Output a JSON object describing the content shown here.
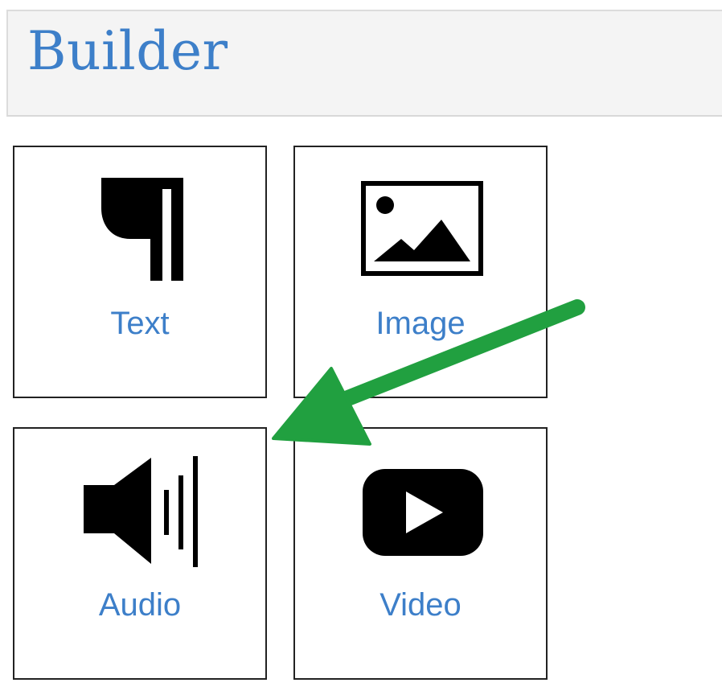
{
  "header": {
    "title": "Builder"
  },
  "colors": {
    "accent": "#3d7fc9",
    "header_background": "#f4f4f4",
    "tile_border": "#222222",
    "icon": "#000000",
    "arrow": "#21a040"
  },
  "tiles": [
    {
      "label": "Text",
      "icon": "pilcrow-icon"
    },
    {
      "label": "Image",
      "icon": "image-icon"
    },
    {
      "label": "Audio",
      "icon": "speaker-icon"
    },
    {
      "label": "Video",
      "icon": "play-icon"
    }
  ],
  "annotation": {
    "icon": "green-arrow-pointer",
    "target": "Audio"
  }
}
